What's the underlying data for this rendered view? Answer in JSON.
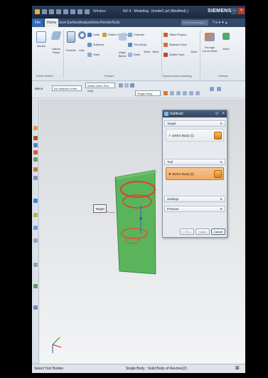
{
  "titlebar": {
    "title": "NX 9 - Modeling - [model1.prt (Modified) ]",
    "brand": "SIEMENS",
    "window_menu": "Window"
  },
  "menubar": {
    "file": "File",
    "tabs": [
      "Home",
      "Curve",
      "Surface",
      "Analysis",
      "View",
      "Render",
      "Tools"
    ],
    "find": "Find a Command"
  },
  "ribbon": {
    "buttons": {
      "sketch": "Sketch",
      "datum": "Datum Plane",
      "extrude": "Extrude",
      "hole": "Hole",
      "unite": "Unite",
      "subtract": "Subtract",
      "shell": "Shell",
      "pattern_feature": "Pattern Feature",
      "edge_blend": "Edge Blend",
      "chamfer": "Chamfer",
      "trim_body": "Trim Body",
      "draft": "Draft",
      "more1": "More",
      "more2": "More",
      "offset_region": "Offset Region",
      "replace_face": "Replace Face",
      "delete_face": "Delete Face",
      "more3": "More",
      "through_curve_mesh": "Through Curve Mesh",
      "more4": "More"
    },
    "groups": {
      "direct_sketch": "Direct Sketch",
      "feature": "Feature",
      "synchronous": "Synchronous Modeling",
      "surface": "Surface"
    }
  },
  "filterbar": {
    "menu": "Menu",
    "filter": "No Selection Filter",
    "scope": "Within Work Part Only",
    "body": "Single Body"
  },
  "viewport": {
    "target_label": "Target"
  },
  "dialog": {
    "title": "Subtract",
    "target_section": "Target",
    "target_field": "Select Body (1)",
    "tool_section": "Tool",
    "tool_field": "Select Body (0)",
    "settings": "Settings",
    "preview": "Preview",
    "ok": "< OK >",
    "apply": "Apply",
    "cancel": "Cancel"
  },
  "statusbar": {
    "left": "Select Tool Bodies",
    "center": "Single Body : Solid Body of Revolve(2)"
  },
  "colors": {
    "accent": "#f0a64a",
    "tool_field": "#f3b77b",
    "body_green": "#59b85a",
    "ring_red": "#d9462e",
    "title_dark": "#1b2940"
  }
}
